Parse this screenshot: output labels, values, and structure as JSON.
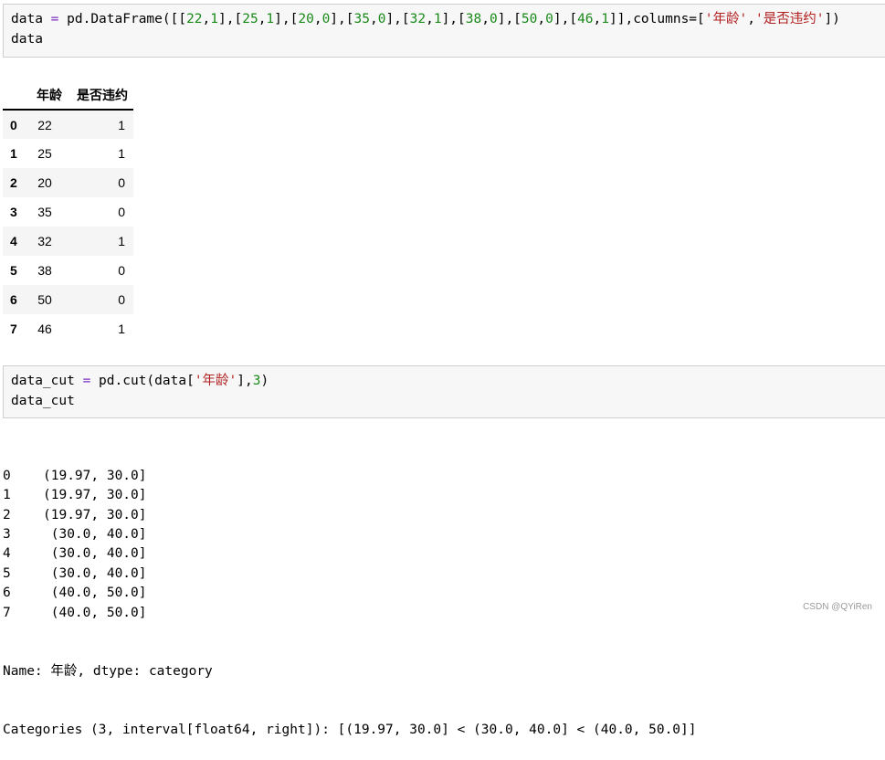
{
  "cells": [
    {
      "tokens": [
        {
          "t": "data",
          "k": "var"
        },
        {
          "t": " = ",
          "k": "op"
        },
        {
          "t": "pd.DataFrame([[",
          "k": "p"
        },
        {
          "t": "22",
          "k": "num"
        },
        {
          "t": ",",
          "k": "p"
        },
        {
          "t": "1",
          "k": "num"
        },
        {
          "t": "],[",
          "k": "p"
        },
        {
          "t": "25",
          "k": "num"
        },
        {
          "t": ",",
          "k": "p"
        },
        {
          "t": "1",
          "k": "num"
        },
        {
          "t": "],[",
          "k": "p"
        },
        {
          "t": "20",
          "k": "num"
        },
        {
          "t": ",",
          "k": "p"
        },
        {
          "t": "0",
          "k": "num"
        },
        {
          "t": "],[",
          "k": "p"
        },
        {
          "t": "35",
          "k": "num"
        },
        {
          "t": ",",
          "k": "p"
        },
        {
          "t": "0",
          "k": "num"
        },
        {
          "t": "],[",
          "k": "p"
        },
        {
          "t": "32",
          "k": "num"
        },
        {
          "t": ",",
          "k": "p"
        },
        {
          "t": "1",
          "k": "num"
        },
        {
          "t": "],[",
          "k": "p"
        },
        {
          "t": "38",
          "k": "num"
        },
        {
          "t": ",",
          "k": "p"
        },
        {
          "t": "0",
          "k": "num"
        },
        {
          "t": "],[",
          "k": "p"
        },
        {
          "t": "50",
          "k": "num"
        },
        {
          "t": ",",
          "k": "p"
        },
        {
          "t": "0",
          "k": "num"
        },
        {
          "t": "],[",
          "k": "p"
        },
        {
          "t": "46",
          "k": "num"
        },
        {
          "t": ",",
          "k": "p"
        },
        {
          "t": "1",
          "k": "num"
        },
        {
          "t": "]],columns=[",
          "k": "p"
        },
        {
          "t": "'年龄'",
          "k": "str"
        },
        {
          "t": ",",
          "k": "p"
        },
        {
          "t": "'是否违约'",
          "k": "str"
        },
        {
          "t": "])",
          "k": "p"
        },
        {
          "t": "\ndata",
          "k": "var"
        }
      ]
    },
    {
      "tokens": [
        {
          "t": "data_cut",
          "k": "var"
        },
        {
          "t": " = ",
          "k": "op"
        },
        {
          "t": "pd.cut(data[",
          "k": "p"
        },
        {
          "t": "'年龄'",
          "k": "str"
        },
        {
          "t": "],",
          "k": "p"
        },
        {
          "t": "3",
          "k": "num"
        },
        {
          "t": ")",
          "k": "p"
        },
        {
          "t": "\ndata_cut",
          "k": "var"
        }
      ]
    }
  ],
  "dataframe": {
    "columns": [
      "年龄",
      "是否违约"
    ],
    "rows": [
      {
        "index": "0",
        "age": "22",
        "default": "1"
      },
      {
        "index": "1",
        "age": "25",
        "default": "1"
      },
      {
        "index": "2",
        "age": "20",
        "default": "0"
      },
      {
        "index": "3",
        "age": "35",
        "default": "0"
      },
      {
        "index": "4",
        "age": "32",
        "default": "1"
      },
      {
        "index": "5",
        "age": "38",
        "default": "0"
      },
      {
        "index": "6",
        "age": "50",
        "default": "0"
      },
      {
        "index": "7",
        "age": "46",
        "default": "1"
      }
    ]
  },
  "series_output": {
    "rows": [
      {
        "index": "0",
        "value": "(19.97, 30.0]"
      },
      {
        "index": "1",
        "value": "(19.97, 30.0]"
      },
      {
        "index": "2",
        "value": "(19.97, 30.0]"
      },
      {
        "index": "3",
        "value": " (30.0, 40.0]"
      },
      {
        "index": "4",
        "value": " (30.0, 40.0]"
      },
      {
        "index": "5",
        "value": " (30.0, 40.0]"
      },
      {
        "index": "6",
        "value": " (40.0, 50.0]"
      },
      {
        "index": "7",
        "value": " (40.0, 50.0]"
      }
    ],
    "name_line": "Name: 年龄, dtype: category",
    "categories_line": "Categories (3, interval[float64, right]): [(19.97, 30.0] < (30.0, 40.0] < (40.0, 50.0]]"
  },
  "watermark": "CSDN @QYiRen"
}
